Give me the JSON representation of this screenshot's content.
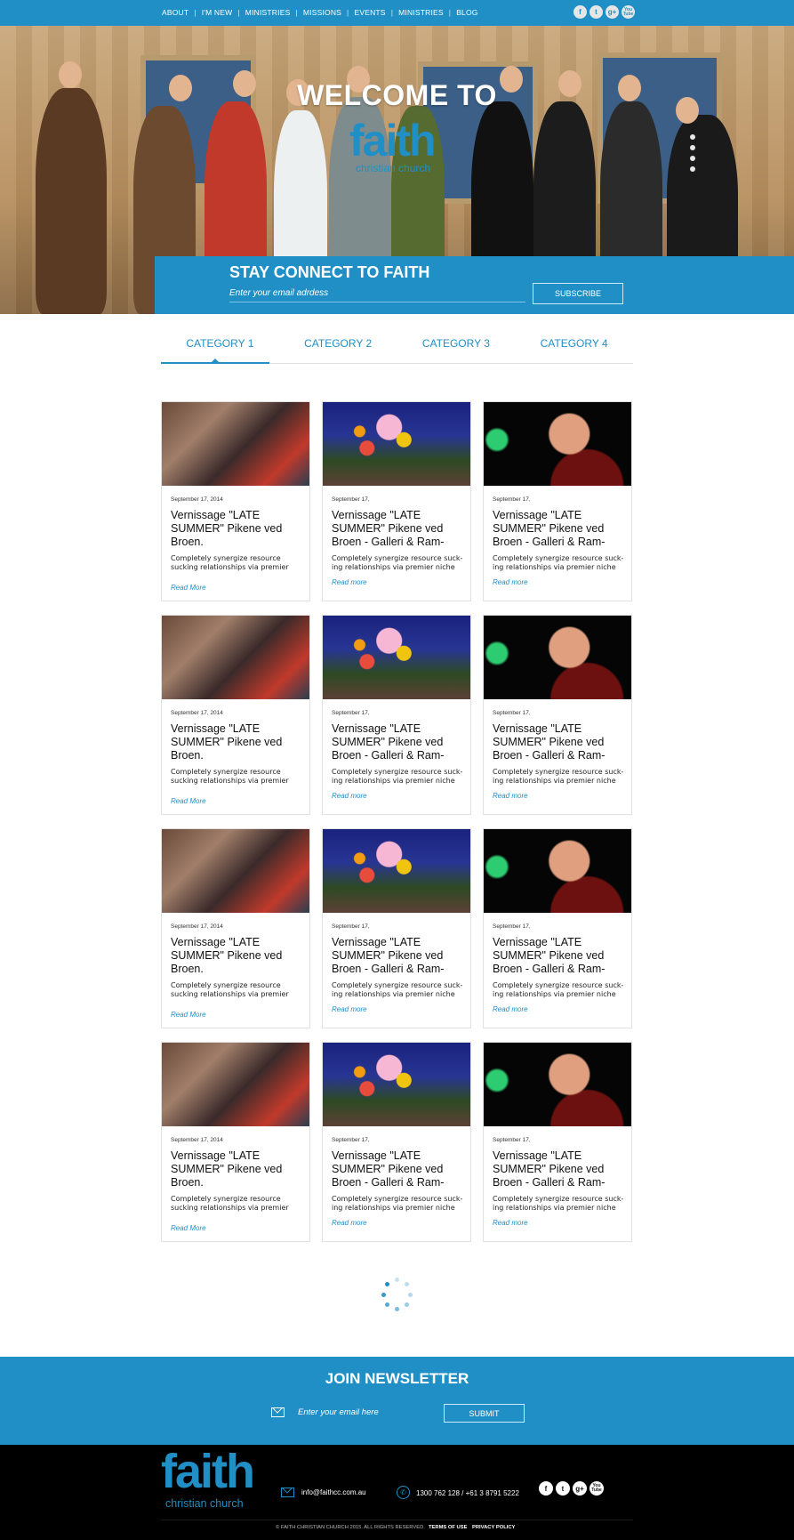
{
  "nav": {
    "items": [
      "ABOUT",
      "I'M NEW",
      "MINISTRIES",
      "MISSIONS",
      "EVENTS",
      "MINISTRIES",
      "BLOG"
    ],
    "social": [
      "f",
      "t",
      "g+",
      "You\nTube"
    ]
  },
  "hero": {
    "title": "WELCOME TO",
    "logo_word": "faith",
    "logo_sub": "christian church"
  },
  "connect": {
    "title": "STAY CONNECT TO FAITH",
    "email_placeholder": "Enter your email adrdess",
    "button": "SUBSCRIBE"
  },
  "tabs": [
    "CATEGORY 1",
    "CATEGORY 2",
    "CATEGORY 3",
    "CATEGORY 4"
  ],
  "cards": [
    {
      "image": "crowd-photo",
      "date": "September 17, 2014",
      "title": "Vernissage \"LATE SUMMER\" Pikene ved Broen.",
      "text": "Completely synergize resource sucking relationships via premier",
      "link": "Read More"
    },
    {
      "image": "flowers-photo",
      "date": "September 17,",
      "title": "Vernissage \"LATE SUMMER\" Pikene ved Broen - Galleri & Ram-",
      "text": "Completely synergize resource suck-ing relationships via premier niche",
      "link": "Read more"
    },
    {
      "image": "speaker-photo",
      "date": "September 17,",
      "title": "Vernissage \"LATE SUMMER\" Pikene ved Broen - Galleri & Ram-",
      "text": "Completely synergize resource suck-ing relationships via premier niche",
      "link": "Read more"
    },
    {
      "image": "crowd-photo",
      "date": "September 17, 2014",
      "title": "Vernissage \"LATE SUMMER\" Pikene ved Broen.",
      "text": "Completely synergize resource sucking relationships via premier",
      "link": "Read More"
    },
    {
      "image": "flowers-photo",
      "date": "September 17,",
      "title": "Vernissage \"LATE SUMMER\" Pikene ved Broen - Galleri & Ram-",
      "text": "Completely synergize resource suck-ing relationships via premier niche",
      "link": "Read more"
    },
    {
      "image": "speaker-photo",
      "date": "September 17,",
      "title": "Vernissage \"LATE SUMMER\" Pikene ved Broen - Galleri & Ram-",
      "text": "Completely synergize resource suck-ing relationships via premier niche",
      "link": "Read more"
    },
    {
      "image": "crowd-photo",
      "date": "September 17, 2014",
      "title": "Vernissage \"LATE SUMMER\" Pikene ved Broen.",
      "text": "Completely synergize resource sucking relationships via premier",
      "link": "Read More"
    },
    {
      "image": "flowers-photo",
      "date": "September 17,",
      "title": "Vernissage \"LATE SUMMER\" Pikene ved Broen - Galleri & Ram-",
      "text": "Completely synergize resource suck-ing relationships via premier niche",
      "link": "Read more"
    },
    {
      "image": "speaker-photo",
      "date": "September 17,",
      "title": "Vernissage \"LATE SUMMER\" Pikene ved Broen - Galleri & Ram-",
      "text": "Completely synergize resource suck-ing relationships via premier niche",
      "link": "Read more"
    },
    {
      "image": "crowd-photo",
      "date": "September 17, 2014",
      "title": "Vernissage \"LATE SUMMER\" Pikene ved Broen.",
      "text": "Completely synergize resource sucking relationships via premier",
      "link": "Read More"
    },
    {
      "image": "flowers-photo",
      "date": "September 17,",
      "title": "Vernissage \"LATE SUMMER\" Pikene ved Broen - Galleri & Ram-",
      "text": "Completely synergize resource suck-ing relationships via premier niche",
      "link": "Read more"
    },
    {
      "image": "speaker-photo",
      "date": "September 17,",
      "title": "Vernissage \"LATE SUMMER\" Pikene ved Broen - Galleri & Ram-",
      "text": "Completely synergize resource suck-ing relationships via premier niche",
      "link": "Read more"
    }
  ],
  "newsletter": {
    "title": "JOIN NEWSLETTER",
    "email_placeholder": "Enter your email here",
    "button": "SUBMIT"
  },
  "footer": {
    "logo_word": "faith",
    "logo_sub": "christian church",
    "email": "info@faithcc.com.au",
    "phone": "1300 762 128 / +61 3 8791 5222",
    "copyright": "© FAITH CHRISTIAN CHURCH 2015. ALL RIGHTS RESERVED.",
    "terms": "TERMS OF USE",
    "privacy": "PRIVACY POLICY"
  },
  "colors": {
    "accent": "#1f8fc5",
    "footer_bg": "#000000"
  }
}
